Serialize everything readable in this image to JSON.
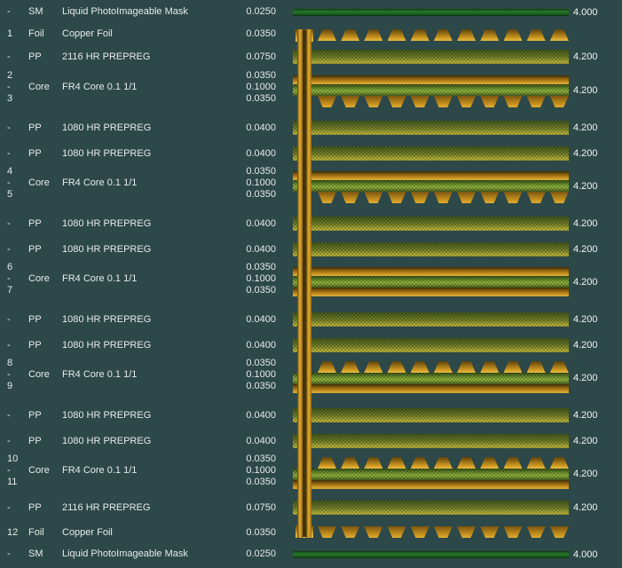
{
  "colors": {
    "background": "#2d4848",
    "text": "#e6ebea",
    "copper": "#cb961f",
    "core_green": "#7da334",
    "prepreg_yellow": "#b7b13c",
    "soldermask_green": "#1d6b22"
  },
  "graphic": {
    "traces_per_band": 11
  },
  "rows": [
    {
      "num": "-",
      "type": "SM",
      "material": "Liquid PhotoImageable Mask",
      "th": "0.0250",
      "er": "4.000"
    },
    {
      "num": "1",
      "type": "Foil",
      "material": "Copper Foil",
      "th": "0.0350"
    },
    {
      "num": "-",
      "type": "PP",
      "material": "2116 HR PREPREG",
      "th": "0.0750",
      "er": "4.200"
    },
    {
      "num1": "2",
      "num2": "-",
      "num3": "3",
      "type": "Core",
      "material": "FR4 Core 0.1 1/1",
      "th1": "0.0350",
      "th2": "0.1000",
      "th3": "0.0350",
      "er": "4.200"
    },
    {
      "num": "-",
      "type": "PP",
      "material": "1080 HR PREPREG",
      "th": "0.0400",
      "er": "4.200"
    },
    {
      "num": "-",
      "type": "PP",
      "material": "1080 HR PREPREG",
      "th": "0.0400",
      "er": "4.200"
    },
    {
      "num1": "4",
      "num2": "-",
      "num3": "5",
      "type": "Core",
      "material": "FR4 Core 0.1 1/1",
      "th1": "0.0350",
      "th2": "0.1000",
      "th3": "0.0350",
      "er": "4.200"
    },
    {
      "num": "-",
      "type": "PP",
      "material": "1080 HR PREPREG",
      "th": "0.0400",
      "er": "4.200"
    },
    {
      "num": "-",
      "type": "PP",
      "material": "1080 HR PREPREG",
      "th": "0.0400",
      "er": "4.200"
    },
    {
      "num1": "6",
      "num2": "-",
      "num3": "7",
      "type": "Core",
      "material": "FR4 Core 0.1 1/1",
      "th1": "0.0350",
      "th2": "0.1000",
      "th3": "0.0350",
      "er": "4.200"
    },
    {
      "num": "-",
      "type": "PP",
      "material": "1080 HR PREPREG",
      "th": "0.0400",
      "er": "4.200"
    },
    {
      "num": "-",
      "type": "PP",
      "material": "1080 HR PREPREG",
      "th": "0.0400",
      "er": "4.200"
    },
    {
      "num1": "8",
      "num2": "-",
      "num3": "9",
      "type": "Core",
      "material": "FR4 Core 0.1 1/1",
      "th1": "0.0350",
      "th2": "0.1000",
      "th3": "0.0350",
      "er": "4.200"
    },
    {
      "num": "-",
      "type": "PP",
      "material": "1080 HR PREPREG",
      "th": "0.0400",
      "er": "4.200"
    },
    {
      "num": "-",
      "type": "PP",
      "material": "1080 HR PREPREG",
      "th": "0.0400",
      "er": "4.200"
    },
    {
      "num1": "10",
      "num2": "-",
      "num3": "11",
      "type": "Core",
      "material": "FR4 Core 0.1 1/1",
      "th1": "0.0350",
      "th2": "0.1000",
      "th3": "0.0350",
      "er": "4.200"
    },
    {
      "num": "-",
      "type": "PP",
      "material": "2116 HR PREPREG",
      "th": "0.0750",
      "er": "4.200"
    },
    {
      "num": "12",
      "type": "Foil",
      "material": "Copper Foil",
      "th": "0.0350"
    },
    {
      "num": "-",
      "type": "SM",
      "material": "Liquid PhotoImageable Mask",
      "th": "0.0250",
      "er": "4.000"
    }
  ]
}
